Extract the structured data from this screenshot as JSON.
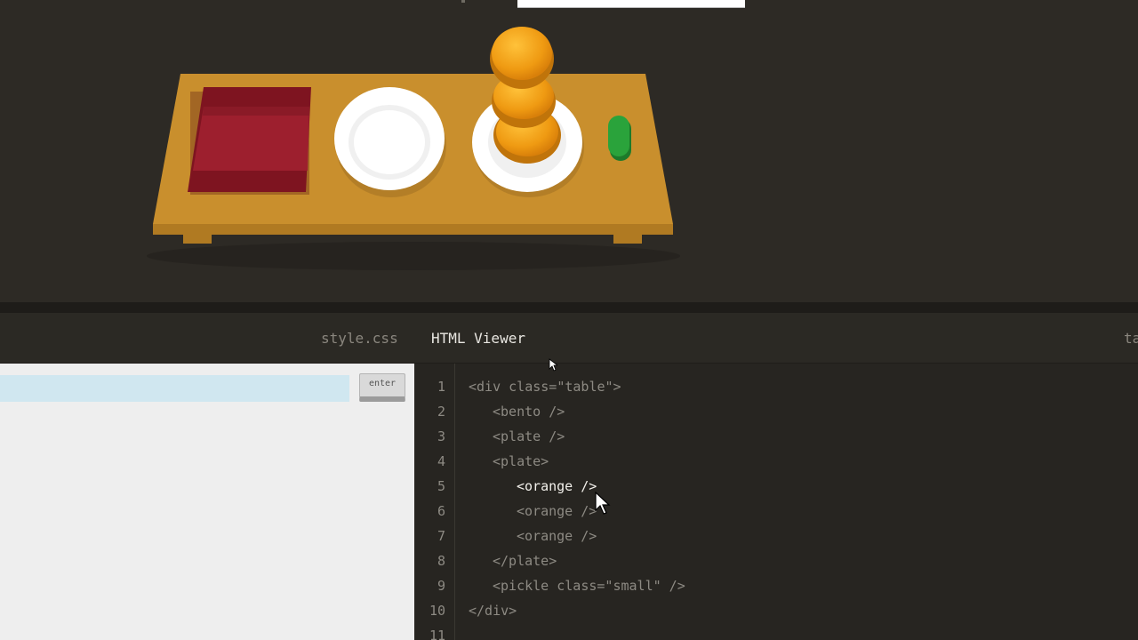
{
  "scene": {
    "table_color": "#c98f2d",
    "bento_color": "#9d1f2e",
    "plate_color": "#ffffff",
    "orange_color": "#ef9a12",
    "pickle_color": "#2aa33b"
  },
  "tabs": {
    "css_label": "style.css",
    "html_label": "HTML Viewer",
    "right_label": "ta"
  },
  "editor": {
    "input_value": "",
    "enter_label": "enter"
  },
  "viewer": {
    "line_numbers": [
      "1",
      "2",
      "3",
      "4",
      "5",
      "6",
      "7",
      "8",
      "9",
      "10",
      "11"
    ],
    "lines": [
      "<div class=\"table\">",
      "<bento />",
      "<plate />",
      "<plate>",
      "<orange />",
      "<orange />",
      "<orange />",
      "</plate>",
      "<pickle class=\"small\" />",
      "</div>",
      ""
    ],
    "highlighted_line": 5
  }
}
